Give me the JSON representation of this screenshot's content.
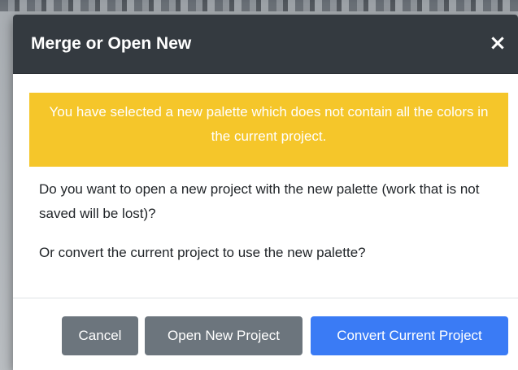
{
  "dialog": {
    "title": "Merge or Open New",
    "close_glyph": "×",
    "close_icon": "close-icon",
    "alert": {
      "text": "You have selected a new palette which does not contain all the colors in the current project.",
      "color": "#f5c62a"
    },
    "paragraphs": [
      "Do you want to open a new project with the new palette (work that is not saved will be lost)?",
      "Or convert the current project to use the new palette?"
    ],
    "buttons": {
      "cancel": "Cancel",
      "open_new": "Open New Project",
      "convert": "Convert Current Project"
    }
  },
  "colors": {
    "header": "#343a40",
    "secondary": "#6c757d",
    "primary": "#3a7bf5",
    "warning": "#f5c62a"
  }
}
